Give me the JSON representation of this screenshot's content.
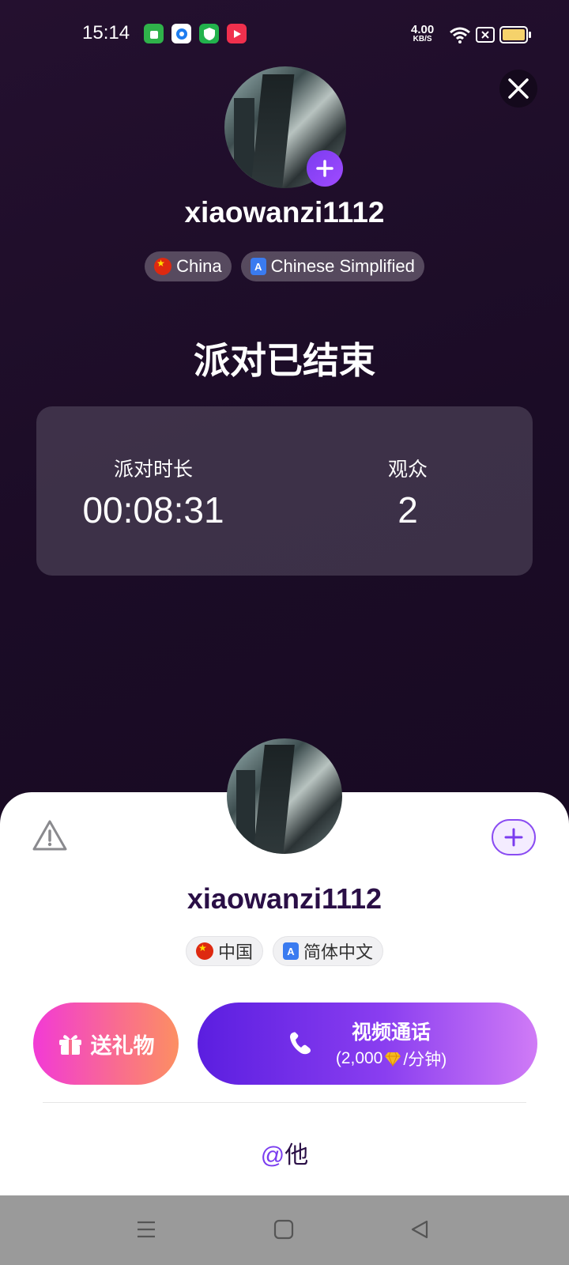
{
  "status_bar": {
    "time": "15:14",
    "net_speed_value": "4.00",
    "net_speed_unit": "KB/S",
    "icons": [
      "app-green-icon",
      "app-blue-icon",
      "shield-icon",
      "video-app-icon",
      "wifi-icon",
      "sim-x-icon",
      "battery-icon"
    ]
  },
  "host": {
    "username": "xiaowanzi1112",
    "country": "China",
    "language": "Chinese Simplified"
  },
  "party": {
    "title": "派对已结束",
    "duration_label": "派对时长",
    "duration_value": "00:08:31",
    "audience_label": "观众",
    "audience_value": "2"
  },
  "sheet": {
    "username": "xiaowanzi1112",
    "country": "中国",
    "language": "简体中文",
    "gift_label": "送礼物",
    "call_label": "视频通话",
    "call_price_prefix": "(2,000",
    "call_price_suffix": "/分钟)",
    "mention_at": "@",
    "mention_text": "他"
  },
  "colors": {
    "accent": "#7a3cef",
    "gift_start": "#f23ad6",
    "gift_end": "#fc8f62",
    "call_start": "#5b1ee0",
    "call_end": "#d07bf6"
  }
}
